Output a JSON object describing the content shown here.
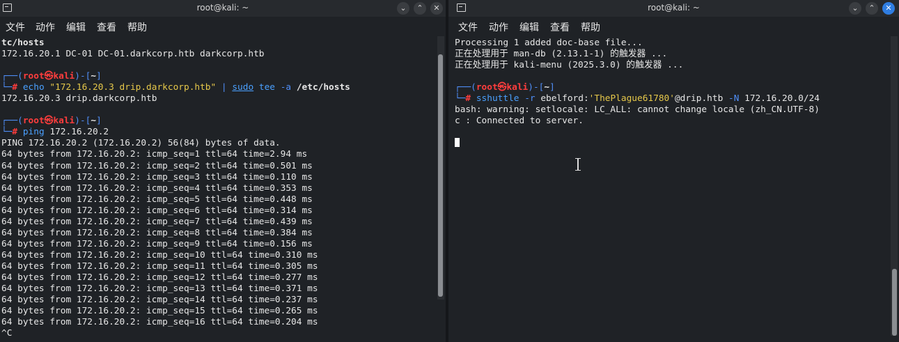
{
  "left": {
    "title": "root@kali: ~",
    "menu": [
      "文件",
      "动作",
      "编辑",
      "查看",
      "帮助"
    ],
    "lines": [
      [
        {
          "t": "tc/hosts",
          "c": "bold"
        }
      ],
      [
        {
          "t": "172.16.20.1 DC-01 DC-01.darkcorp.htb darkcorp.htb"
        }
      ],
      [
        {
          "t": ""
        }
      ],
      [
        {
          "t": "┌──(",
          "c": "blue"
        },
        {
          "t": "root㉿kali",
          "c": "red"
        },
        {
          "t": ")-[",
          "c": "blue"
        },
        {
          "t": "~",
          "c": "bold"
        },
        {
          "t": "]",
          "c": "blue"
        }
      ],
      [
        {
          "t": "└─",
          "c": "blue"
        },
        {
          "t": "#",
          "c": "red"
        },
        {
          "t": " echo ",
          "c": "cmd"
        },
        {
          "t": "\"172.16.20.3 drip.darkcorp.htb\"",
          "c": "str"
        },
        {
          "t": " | ",
          "c": "blue"
        },
        {
          "t": "sudo",
          "c": "cmd ul"
        },
        {
          "t": " tee ",
          "c": "cmd"
        },
        {
          "t": "-a",
          "c": "blue"
        },
        {
          "t": " /etc/hosts",
          "c": "bold"
        }
      ],
      [
        {
          "t": "172.16.20.3 drip.darkcorp.htb"
        }
      ],
      [
        {
          "t": ""
        }
      ],
      [
        {
          "t": "┌──(",
          "c": "blue"
        },
        {
          "t": "root㉿kali",
          "c": "red"
        },
        {
          "t": ")-[",
          "c": "blue"
        },
        {
          "t": "~",
          "c": "bold"
        },
        {
          "t": "]",
          "c": "blue"
        }
      ],
      [
        {
          "t": "└─",
          "c": "blue"
        },
        {
          "t": "#",
          "c": "red"
        },
        {
          "t": " ping ",
          "c": "cmd"
        },
        {
          "t": "172.16.20.2"
        }
      ],
      [
        {
          "t": "PING 172.16.20.2 (172.16.20.2) 56(84) bytes of data."
        }
      ],
      [
        {
          "t": "64 bytes from 172.16.20.2: icmp_seq=1 ttl=64 time=2.94 ms"
        }
      ],
      [
        {
          "t": "64 bytes from 172.16.20.2: icmp_seq=2 ttl=64 time=0.501 ms"
        }
      ],
      [
        {
          "t": "64 bytes from 172.16.20.2: icmp_seq=3 ttl=64 time=0.110 ms"
        }
      ],
      [
        {
          "t": "64 bytes from 172.16.20.2: icmp_seq=4 ttl=64 time=0.353 ms"
        }
      ],
      [
        {
          "t": "64 bytes from 172.16.20.2: icmp_seq=5 ttl=64 time=0.448 ms"
        }
      ],
      [
        {
          "t": "64 bytes from 172.16.20.2: icmp_seq=6 ttl=64 time=0.314 ms"
        }
      ],
      [
        {
          "t": "64 bytes from 172.16.20.2: icmp_seq=7 ttl=64 time=0.439 ms"
        }
      ],
      [
        {
          "t": "64 bytes from 172.16.20.2: icmp_seq=8 ttl=64 time=0.384 ms"
        }
      ],
      [
        {
          "t": "64 bytes from 172.16.20.2: icmp_seq=9 ttl=64 time=0.156 ms"
        }
      ],
      [
        {
          "t": "64 bytes from 172.16.20.2: icmp_seq=10 ttl=64 time=0.310 ms"
        }
      ],
      [
        {
          "t": "64 bytes from 172.16.20.2: icmp_seq=11 ttl=64 time=0.305 ms"
        }
      ],
      [
        {
          "t": "64 bytes from 172.16.20.2: icmp_seq=12 ttl=64 time=0.277 ms"
        }
      ],
      [
        {
          "t": "64 bytes from 172.16.20.2: icmp_seq=13 ttl=64 time=0.371 ms"
        }
      ],
      [
        {
          "t": "64 bytes from 172.16.20.2: icmp_seq=14 ttl=64 time=0.237 ms"
        }
      ],
      [
        {
          "t": "64 bytes from 172.16.20.2: icmp_seq=15 ttl=64 time=0.265 ms"
        }
      ],
      [
        {
          "t": "64 bytes from 172.16.20.2: icmp_seq=16 ttl=64 time=0.204 ms"
        }
      ],
      [
        {
          "t": "^C"
        }
      ]
    ]
  },
  "right": {
    "title": "root@kali: ~",
    "menu": [
      "文件",
      "动作",
      "编辑",
      "查看",
      "帮助"
    ],
    "lines": [
      [
        {
          "t": "Processing 1 added doc-base file..."
        }
      ],
      [
        {
          "t": "正在处理用于 man-db (2.13.1-1) 的触发器 ..."
        }
      ],
      [
        {
          "t": "正在处理用于 kali-menu (2025.3.0) 的触发器 ..."
        }
      ],
      [
        {
          "t": ""
        }
      ],
      [
        {
          "t": "┌──(",
          "c": "blue"
        },
        {
          "t": "root㉿kali",
          "c": "red"
        },
        {
          "t": ")-[",
          "c": "blue"
        },
        {
          "t": "~",
          "c": "bold"
        },
        {
          "t": "]",
          "c": "blue"
        }
      ],
      [
        {
          "t": "└─",
          "c": "blue"
        },
        {
          "t": "#",
          "c": "red"
        },
        {
          "t": " sshuttle ",
          "c": "cmd"
        },
        {
          "t": "-r",
          "c": "blue"
        },
        {
          "t": " ebelford:"
        },
        {
          "t": "'ThePlague61780'",
          "c": "str"
        },
        {
          "t": "@drip.htb "
        },
        {
          "t": "-N",
          "c": "blue"
        },
        {
          "t": " 172.16.20.0/24"
        }
      ],
      [
        {
          "t": "bash: warning: setlocale: LC_ALL: cannot change locale (zh_CN.UTF-8)"
        }
      ],
      [
        {
          "t": "c : Connected to server."
        }
      ],
      [
        {
          "t": ""
        }
      ],
      [
        {
          "t": "CURSOR"
        }
      ]
    ]
  }
}
